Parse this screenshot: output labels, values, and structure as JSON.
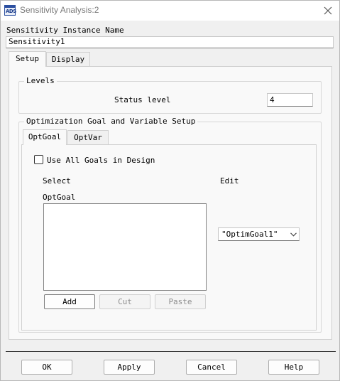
{
  "window": {
    "title": "Sensitivity Analysis:2"
  },
  "instance": {
    "label": "Sensitivity Instance Name",
    "value": "Sensitivity1"
  },
  "tabs": {
    "setup": "Setup",
    "display": "Display"
  },
  "levels": {
    "group_title": "Levels",
    "status_label": "Status level",
    "status_value": "4"
  },
  "opt": {
    "group_title": "Optimization Goal and Variable Setup",
    "tabs": {
      "goal": "OptGoal",
      "var": "OptVar"
    },
    "use_all_goals": {
      "label": "Use All Goals in Design",
      "checked": false
    },
    "select_label": "Select",
    "list_label": "OptGoal",
    "list_items": [],
    "edit_label": "Edit",
    "edit_value": "\"OptimGoal1\"",
    "buttons": {
      "add": "Add",
      "cut": "Cut",
      "paste": "Paste"
    }
  },
  "footer": {
    "ok": "OK",
    "apply": "Apply",
    "cancel": "Cancel",
    "help": "Help"
  }
}
